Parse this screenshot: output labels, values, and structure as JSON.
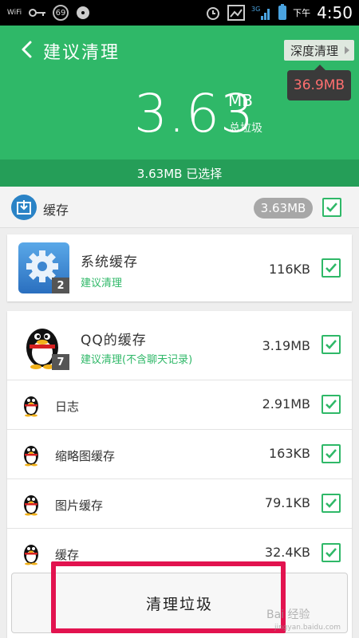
{
  "statusbar": {
    "wifi_label": "WiFi",
    "badge_number": "69",
    "ampm": "下午",
    "time": "4:50",
    "network": "3G"
  },
  "header": {
    "title": "建议清理",
    "deep_clean_label": "深度清理",
    "deep_clean_size": "36.9MB",
    "total_size": "3.63",
    "total_unit": "MB",
    "total_label": "总垃圾",
    "selected_text": "3.63MB 已选择"
  },
  "category": {
    "label": "缓存",
    "size": "3.63MB"
  },
  "items": [
    {
      "title": "系统缓存",
      "subtitle": "建议清理",
      "size": "116KB",
      "badge": "2"
    },
    {
      "title": "QQ的缓存",
      "subtitle": "建议清理(不含聊天记录)",
      "size": "3.19MB",
      "badge": "7",
      "children": [
        {
          "label": "日志",
          "size": "2.91MB"
        },
        {
          "label": "缩略图缓存",
          "size": "163KB"
        },
        {
          "label": "图片缓存",
          "size": "79.1KB"
        },
        {
          "label": "缓存",
          "size": "32.4KB"
        }
      ]
    }
  ],
  "bottom": {
    "clean_button": "清理垃圾"
  },
  "watermark": {
    "line1": "Bai 经验",
    "line2": "jingyan.baidu.com"
  },
  "colors": {
    "accent": "#2fb868",
    "highlight": "#e2134f",
    "tooltip_text": "#ff6f6f"
  }
}
